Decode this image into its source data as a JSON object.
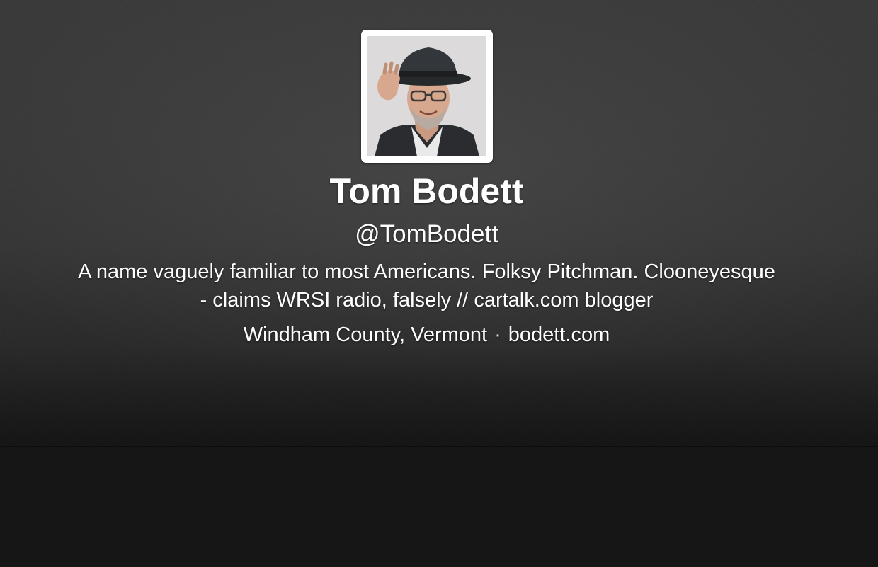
{
  "profile": {
    "name": "Tom Bodett",
    "handle": "@TomBodett",
    "bio": "A name vaguely familiar to most Americans. Folksy Pitchman.  Clooneyesque\n- claims WRSI radio, falsely // cartalk.com blogger",
    "location": "Windham County, Vermont",
    "separator": "·",
    "website": "bodett.com"
  },
  "colors": {
    "header_background": "#363636",
    "lower_background": "#161617",
    "text": "#ffffff",
    "avatar_frame": "#ffffff"
  }
}
